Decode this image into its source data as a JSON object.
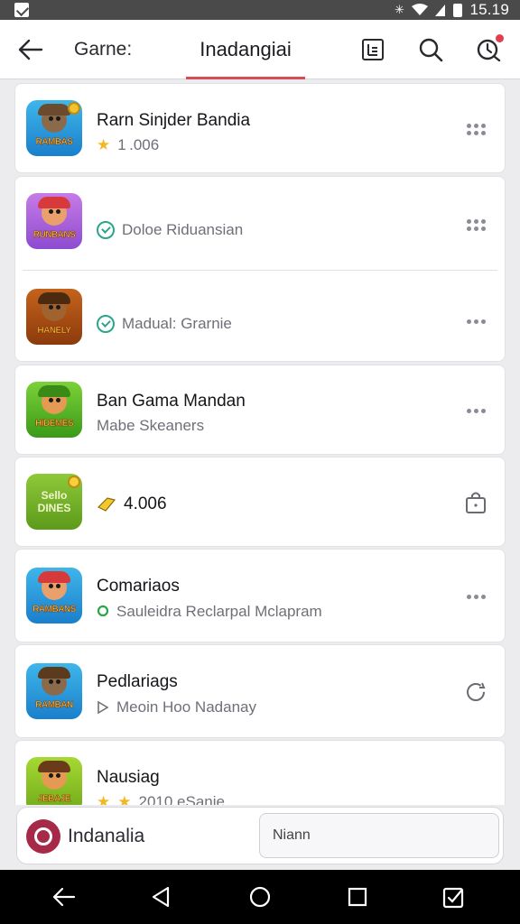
{
  "status_bar": {
    "time": "15.19",
    "bluetooth_icon": "bluetooth-icon",
    "wifi_icon": "wifi-icon",
    "battery_icon": "battery-icon"
  },
  "header": {
    "back_icon": "arrow-left-icon",
    "title": "Garne:",
    "active_tab": "Inadangiai",
    "accent": "#d94b56",
    "actions": [
      "list-icon",
      "search-icon",
      "history-icon"
    ]
  },
  "items": [
    {
      "title": "Rarn Sinjder Bandia",
      "subtitle": "1 .006",
      "subtitle_icon": "star-icon",
      "action_icon": "more-grid-icon"
    },
    {
      "title": "",
      "subtitle": "Doloe Riduansian",
      "subtitle_icon": "check-circle-icon",
      "action_icon": "more-grid-icon"
    },
    {
      "title": "",
      "subtitle": "Madual: Grarnie",
      "subtitle_icon": "check-circle-icon",
      "action_icon": "more-horizontal-icon"
    },
    {
      "title": "Ban Gama Mandan",
      "subtitle": "Mabe Skeaners",
      "subtitle_icon": "",
      "action_icon": "more-horizontal-icon"
    },
    {
      "title": "",
      "subtitle": "4.006",
      "subtitle_icon": "tag-icon",
      "action_icon": "bag-icon",
      "icon_text": "Sello\nDINES"
    },
    {
      "title": "Comariaos",
      "subtitle": "Sauleidra Reclarpal Mclapram",
      "subtitle_icon": "location-icon",
      "action_icon": "more-horizontal-icon"
    },
    {
      "title": "Pedlariags",
      "subtitle": "Meoin Hoo Nadanay",
      "subtitle_icon": "play-icon",
      "action_icon": "refresh-icon"
    },
    {
      "title": "Nausiag",
      "subtitle": "2010  eSanie",
      "subtitle_icon": "star-icon",
      "action_icon": ""
    }
  ],
  "icon_labels": [
    "RAMBAS",
    "RUNBANS",
    "HANELY",
    "HIDEMES",
    "",
    "RAMBANS",
    "RAMBAN",
    "JEBAJE"
  ],
  "search": {
    "label": "Indanalia",
    "value": "Niann"
  },
  "nav": [
    "back-icon",
    "home-triangle-icon",
    "home-circle-icon",
    "recents-square-icon",
    "checklist-icon"
  ]
}
